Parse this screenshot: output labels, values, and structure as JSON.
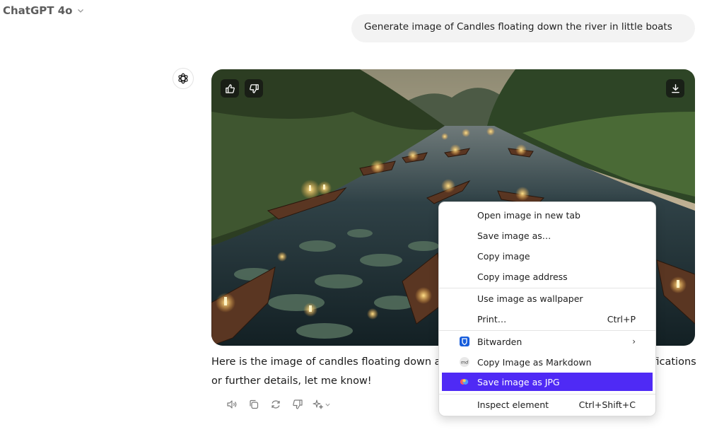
{
  "header": {
    "model_name": "ChatGPT 4o"
  },
  "user_message": {
    "text": "Generate image of Candles floating down the river in little boats"
  },
  "response": {
    "text": "Here is the image of candles floating down a river in little boats. If you have any modifications or further details, let me know!"
  },
  "context_menu": {
    "items": [
      {
        "label": "Open image in new tab"
      },
      {
        "label": "Save image as…"
      },
      {
        "label": "Copy image"
      },
      {
        "label": "Copy image address"
      },
      {
        "label": "Use image as wallpaper"
      },
      {
        "label": "Print…",
        "shortcut": "Ctrl+P"
      },
      {
        "label": "Bitwarden",
        "icon": "bitwarden-icon"
      },
      {
        "label": "Copy Image as Markdown",
        "icon": "markdown-icon",
        "icon_text": "md"
      },
      {
        "label": "Save image as JPG",
        "icon": "save-jpg-extension-icon"
      },
      {
        "label": "Inspect element",
        "shortcut": "Ctrl+Shift+C"
      }
    ]
  },
  "colors": {
    "menu_highlight": "#4f2af5",
    "bitwarden_blue": "#175ddc",
    "bubble_bg": "#f3f3f3"
  }
}
